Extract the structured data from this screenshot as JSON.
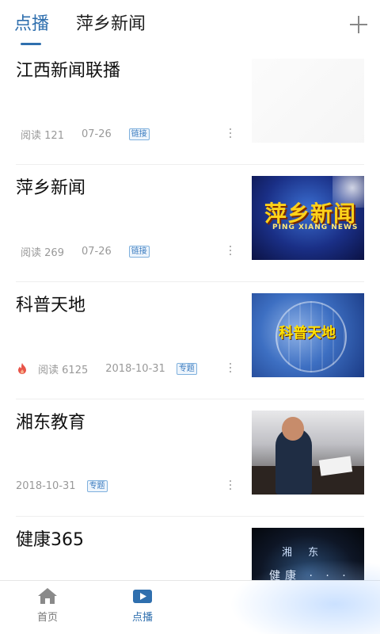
{
  "header": {
    "tabs": [
      {
        "label": "点播",
        "active": true
      },
      {
        "label": "萍乡新闻",
        "active": false
      }
    ],
    "add_icon": "plus-icon"
  },
  "items": [
    {
      "title": "江西新闻联播",
      "meta": [
        "阅读",
        "121",
        "07-26"
      ],
      "tag": "链接",
      "hot": false,
      "thumb": "faded"
    },
    {
      "title": "萍乡新闻",
      "meta": [
        "阅读",
        "269",
        "07-26"
      ],
      "tag": "链接",
      "hot": false,
      "thumb": "news",
      "thumb_text": [
        "萍乡新闻",
        "PING XIANG NEWS"
      ]
    },
    {
      "title": "科普天地",
      "meta": [
        "阅读",
        "6125",
        "2018-10-31"
      ],
      "tag": "专题",
      "hot": true,
      "thumb": "science",
      "thumb_text": [
        "科普天地"
      ]
    },
    {
      "title": "湘东教育",
      "meta": [
        "2018-10-31"
      ],
      "tag": "专题",
      "hot": false,
      "thumb": "edu"
    },
    {
      "title": "健康365",
      "meta": [],
      "tag": "",
      "hot": false,
      "thumb": "health",
      "thumb_text": [
        "湘 东",
        "健康 · · ·"
      ]
    }
  ],
  "bottom_nav": [
    {
      "label": "首页",
      "icon": "home-icon",
      "active": false
    },
    {
      "label": "点播",
      "icon": "play-icon",
      "active": true
    }
  ],
  "colors": {
    "accent": "#2f6fae",
    "tag": "#3a7bbf",
    "meta": "#999999"
  }
}
